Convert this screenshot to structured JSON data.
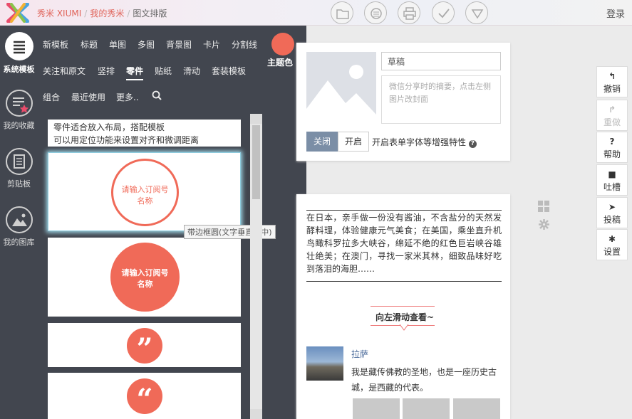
{
  "breadcrumb": {
    "home": "秀米 XIUMI",
    "mine": "我的秀米",
    "current": "图文排版"
  },
  "toolbar": {
    "icons": [
      "folder-icon",
      "save-icon",
      "print-icon",
      "check-icon",
      "dropdown-icon"
    ]
  },
  "login": "登录",
  "rail": [
    {
      "label": "系统模板",
      "icon": "menu-icon"
    },
    {
      "label": "我的收藏",
      "icon": "favorite-icon"
    },
    {
      "label": "剪贴板",
      "icon": "clipboard-icon"
    },
    {
      "label": "我的图库",
      "icon": "image-icon"
    }
  ],
  "categories": {
    "row1": [
      "新模板",
      "标题",
      "单图",
      "多图",
      "背景图",
      "卡片",
      "分割线"
    ],
    "row2": [
      "关注和原文",
      "竖排",
      "零件",
      "贴纸",
      "滑动",
      "套装模板"
    ],
    "row3": [
      "组合",
      "最近使用",
      "更多.."
    ],
    "active": "零件"
  },
  "theme": {
    "label": "主题色",
    "color": "#f06a58"
  },
  "templates": {
    "intro": [
      "零件适合放入布局，搭配模板",
      "可以用定位功能来设置对齐和微调距离"
    ],
    "card1": [
      "请输入订阅号",
      "名称"
    ],
    "card2": [
      "请输入订阅号",
      "名称"
    ],
    "card3_glyph": "”",
    "card4_glyph": "“"
  },
  "tooltip": "带边框圆(文字垂直居中)",
  "cover": {
    "title": "草稿",
    "summary": "微信分享时的摘要，点击左侧图片改封面",
    "toggle_off": "关闭",
    "toggle_on": "开启",
    "toggle_label": "开启表单字体等增强特性"
  },
  "article": {
    "body": "在日本，亲手做一份没有酱油，不含盐分的天然发酵料理，体验健康元气美食；在美国，乘坐直升机鸟瞰科罗拉多大峡谷，绵延不绝的红色巨岩峡谷雄壮绝美；在澳门，寻找一家米其林，细致品味好吃到落泪的海胆……",
    "swipe": "向左滑动查看~",
    "location_name": "拉萨",
    "location_desc": "我是藏传佛教的圣地，也是一座历史古城，是西藏的代表。"
  },
  "right_toolbar": [
    {
      "label": "撤销",
      "glyph": "↰"
    },
    {
      "label": "重做",
      "glyph": "↱"
    },
    {
      "label": "帮助",
      "glyph": "?"
    },
    {
      "label": "吐槽",
      "glyph": "■"
    },
    {
      "label": "投稿",
      "glyph": "➤"
    },
    {
      "label": "设置",
      "glyph": "✱"
    }
  ]
}
